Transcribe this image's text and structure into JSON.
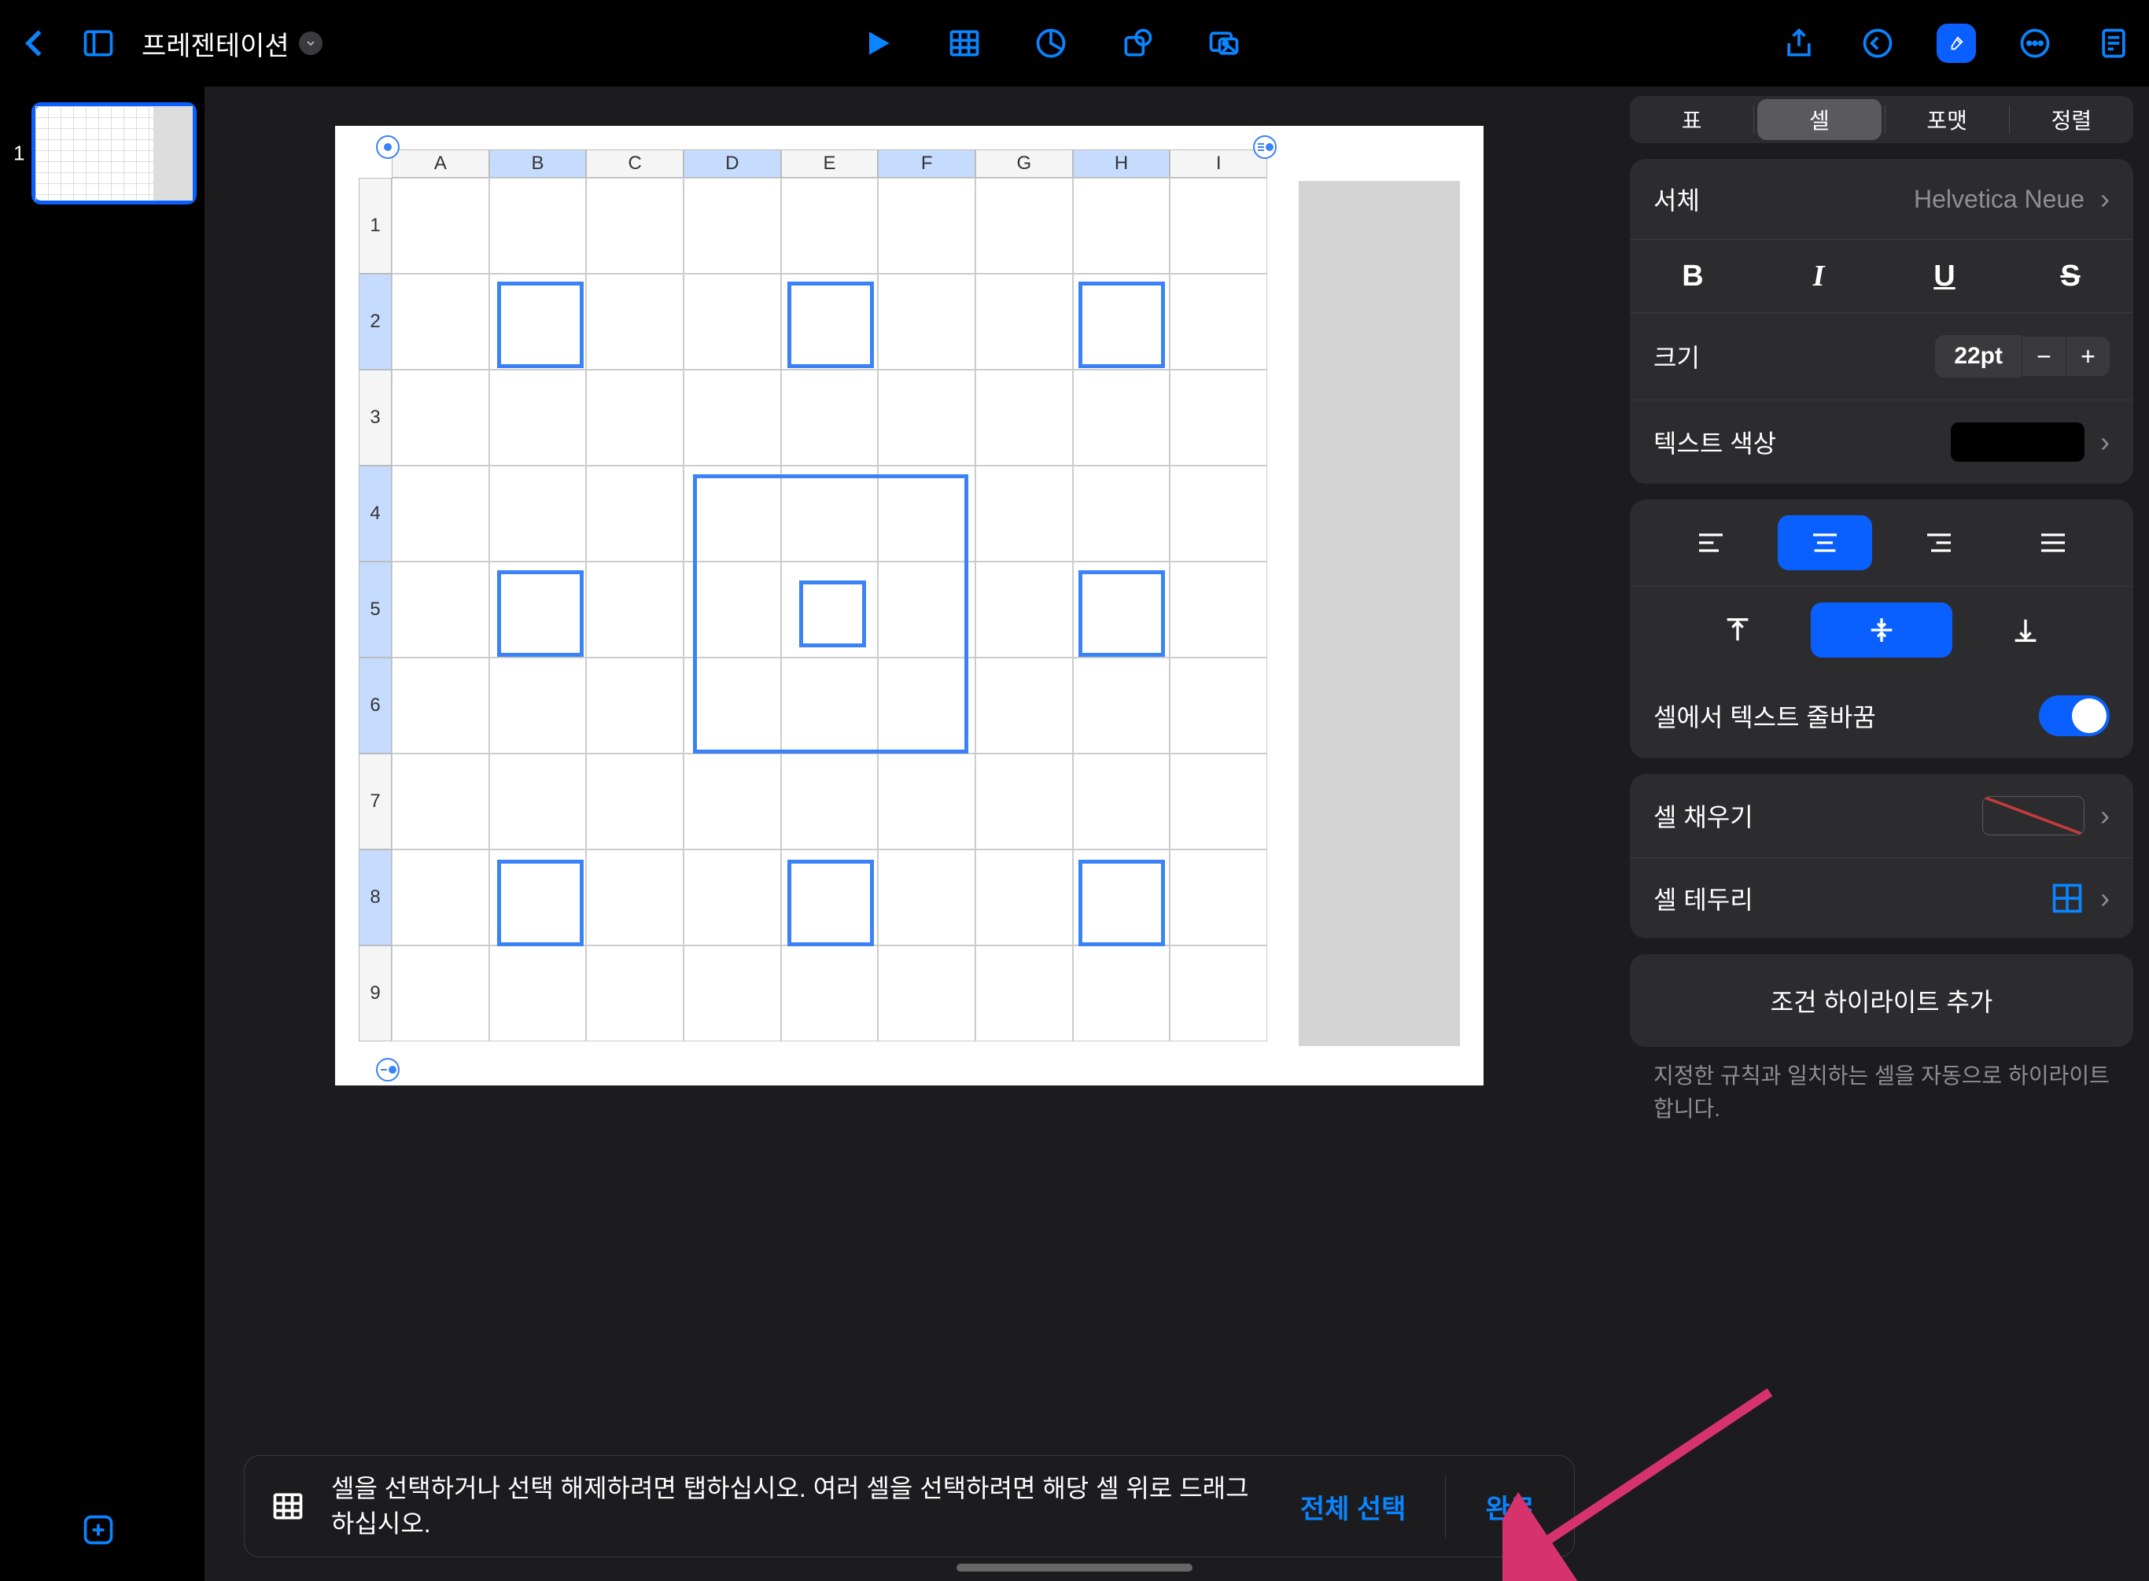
{
  "toolbar": {
    "doc_title": "프레젠테이션"
  },
  "slides": {
    "current_index": "1"
  },
  "table": {
    "columns": [
      "A",
      "B",
      "C",
      "D",
      "E",
      "F",
      "G",
      "H",
      "I"
    ],
    "rows": [
      "1",
      "2",
      "3",
      "4",
      "5",
      "6",
      "7",
      "8",
      "9"
    ],
    "selected_cols": [
      "B",
      "D",
      "F",
      "H"
    ],
    "selected_rows": [
      "2",
      "4",
      "5",
      "6",
      "8"
    ]
  },
  "bottom": {
    "hint": "셀을 선택하거나 선택 해제하려면 탭하십시오. 여러 셀을 선택하려면 해당 셀 위로 드래그하십시오.",
    "select_all": "전체 선택",
    "done": "완료"
  },
  "inspector": {
    "tabs": {
      "table": "표",
      "cell": "셀",
      "format": "포맷",
      "arrange": "정렬"
    },
    "font": {
      "label": "서체",
      "value": "Helvetica Neue"
    },
    "style": {
      "bold": "B",
      "italic": "I",
      "underline": "U",
      "strike": "S"
    },
    "size": {
      "label": "크기",
      "value": "22pt"
    },
    "text_color": {
      "label": "텍스트 색상",
      "value": "#000000"
    },
    "wrap": {
      "label": "셀에서 텍스트 줄바꿈"
    },
    "fill": {
      "label": "셀 채우기"
    },
    "border": {
      "label": "셀 테두리"
    },
    "highlight": {
      "button": "조건 하이라이트 추가",
      "hint": "지정한 규칙과 일치하는 셀을 자동으로 하이라이트합니다."
    }
  }
}
